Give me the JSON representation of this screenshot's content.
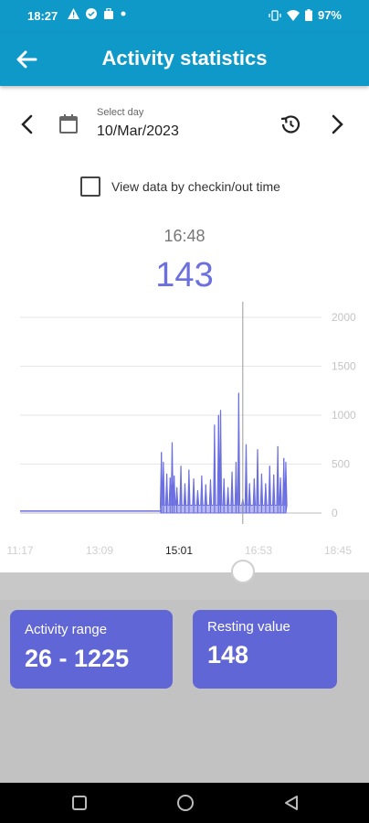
{
  "status": {
    "time": "18:27",
    "battery": "97%"
  },
  "header": {
    "title": "Activity statistics"
  },
  "day_selector": {
    "label": "Select day",
    "value": "10/Mar/2023"
  },
  "checkbox": {
    "label": "View data by checkin/out time",
    "checked": false
  },
  "selection": {
    "time": "16:48",
    "value": "143"
  },
  "chart_data": {
    "type": "bar",
    "x_tick_labels": [
      "11:17",
      "13:09",
      "15:01",
      "16:53",
      "18:45"
    ],
    "highlighted_x_tick": "15:01",
    "y_tick_labels": [
      "2000",
      "1500",
      "1000",
      "500",
      "0"
    ],
    "ylim": [
      0,
      2000
    ],
    "grid": true,
    "cursor_x": "16:48",
    "series_color": "#6b6fe0",
    "x_range": [
      "11:17",
      "18:45"
    ],
    "activity_start": "14:46",
    "activity_end": "17:52",
    "baseline": 20,
    "spikes": [
      {
        "x": "14:47",
        "y": 620
      },
      {
        "x": "14:50",
        "y": 520
      },
      {
        "x": "14:55",
        "y": 400
      },
      {
        "x": "15:00",
        "y": 360
      },
      {
        "x": "15:03",
        "y": 720
      },
      {
        "x": "15:06",
        "y": 380
      },
      {
        "x": "15:10",
        "y": 260
      },
      {
        "x": "15:16",
        "y": 480
      },
      {
        "x": "15:22",
        "y": 300
      },
      {
        "x": "15:28",
        "y": 440
      },
      {
        "x": "15:35",
        "y": 350
      },
      {
        "x": "15:41",
        "y": 230
      },
      {
        "x": "15:47",
        "y": 380
      },
      {
        "x": "15:53",
        "y": 290
      },
      {
        "x": "16:00",
        "y": 340
      },
      {
        "x": "16:06",
        "y": 900
      },
      {
        "x": "16:12",
        "y": 1000
      },
      {
        "x": "16:15",
        "y": 1050
      },
      {
        "x": "16:20",
        "y": 350
      },
      {
        "x": "16:26",
        "y": 260
      },
      {
        "x": "16:32",
        "y": 420
      },
      {
        "x": "16:38",
        "y": 520
      },
      {
        "x": "16:42",
        "y": 1225
      },
      {
        "x": "16:48",
        "y": 143
      },
      {
        "x": "16:53",
        "y": 700
      },
      {
        "x": "16:58",
        "y": 300
      },
      {
        "x": "17:05",
        "y": 350
      },
      {
        "x": "17:10",
        "y": 650
      },
      {
        "x": "17:16",
        "y": 400
      },
      {
        "x": "17:22",
        "y": 300
      },
      {
        "x": "17:28",
        "y": 480
      },
      {
        "x": "17:34",
        "y": 390
      },
      {
        "x": "17:40",
        "y": 680
      },
      {
        "x": "17:44",
        "y": 360
      },
      {
        "x": "17:49",
        "y": 560
      },
      {
        "x": "17:52",
        "y": 520
      }
    ]
  },
  "cards": [
    {
      "label": "Activity range",
      "value": "26 - 1225"
    },
    {
      "label": "Resting value",
      "value": "148"
    }
  ],
  "colors": {
    "primary": "#0f99c9",
    "accent": "#6166d6",
    "chart": "#6b6fe0"
  }
}
